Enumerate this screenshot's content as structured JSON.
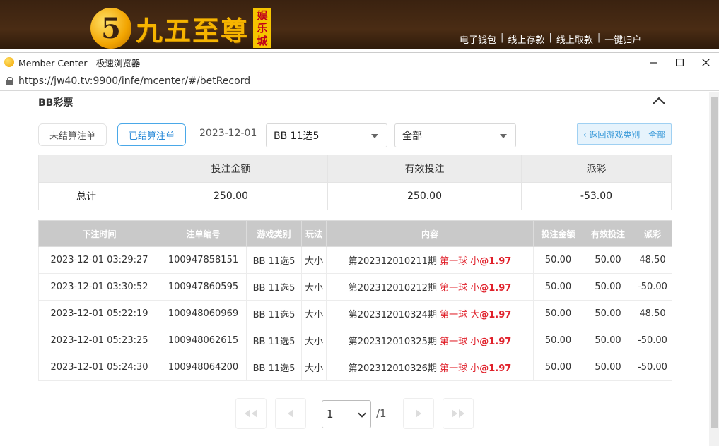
{
  "site": {
    "logo_mark": "5",
    "logo_text": "九五至尊",
    "logo_tag": [
      "娱",
      "乐",
      "城"
    ],
    "top_links": [
      "电子钱包",
      "线上存款",
      "线上取款",
      "一键归户"
    ]
  },
  "window": {
    "title": "Member Center - 极速浏览器",
    "url": "https://jw40.tv:9900/infe/mcenter/#/betRecord"
  },
  "section": {
    "title": "BB彩票"
  },
  "filters": {
    "tab_unsettled": "未结算注单",
    "tab_settled": "已结算注单",
    "date": "2023-12-01",
    "game_select": "BB 11选5",
    "type_select": "全部",
    "back_button": "‹ 返回游戏类别 - 全部"
  },
  "summary": {
    "headers": [
      "投注金额",
      "有效投注",
      "派彩"
    ],
    "label": "总计",
    "bet_amount": "250.00",
    "valid_bet": "250.00",
    "payout": "-53.00"
  },
  "table": {
    "headers": [
      "下注时间",
      "注单编号",
      "游戏类别",
      "玩法",
      "内容",
      "投注金额",
      "有效投注",
      "派彩"
    ],
    "rows": [
      {
        "time": "2023-12-01 03:29:27",
        "id": "100947858151",
        "game": "BB 11选5",
        "play": "大小",
        "period": "第202312010211期",
        "pick": "第一球 小",
        "odds": "@1.97",
        "bet": "50.00",
        "valid": "50.00",
        "payout": "48.50"
      },
      {
        "time": "2023-12-01 03:30:52",
        "id": "100947860595",
        "game": "BB 11选5",
        "play": "大小",
        "period": "第202312010212期",
        "pick": "第一球 小",
        "odds": "@1.97",
        "bet": "50.00",
        "valid": "50.00",
        "payout": "-50.00"
      },
      {
        "time": "2023-12-01 05:22:19",
        "id": "100948060969",
        "game": "BB 11选5",
        "play": "大小",
        "period": "第202312010324期",
        "pick": "第一球 大",
        "odds": "@1.97",
        "bet": "50.00",
        "valid": "50.00",
        "payout": "48.50"
      },
      {
        "time": "2023-12-01 05:23:25",
        "id": "100948062615",
        "game": "BB 11选5",
        "play": "大小",
        "period": "第202312010325期",
        "pick": "第一球 小",
        "odds": "@1.97",
        "bet": "50.00",
        "valid": "50.00",
        "payout": "-50.00"
      },
      {
        "time": "2023-12-01 05:24:30",
        "id": "100948064200",
        "game": "BB 11选5",
        "play": "大小",
        "period": "第202312010326期",
        "pick": "第一球 小",
        "odds": "@1.97",
        "bet": "50.00",
        "valid": "50.00",
        "payout": "-50.00"
      }
    ]
  },
  "pagination": {
    "current": "1",
    "total": "/1"
  },
  "colors": {
    "negative": "#e0334a",
    "accent": "#2a8ad8",
    "header_bg": "#c9c9c9"
  }
}
